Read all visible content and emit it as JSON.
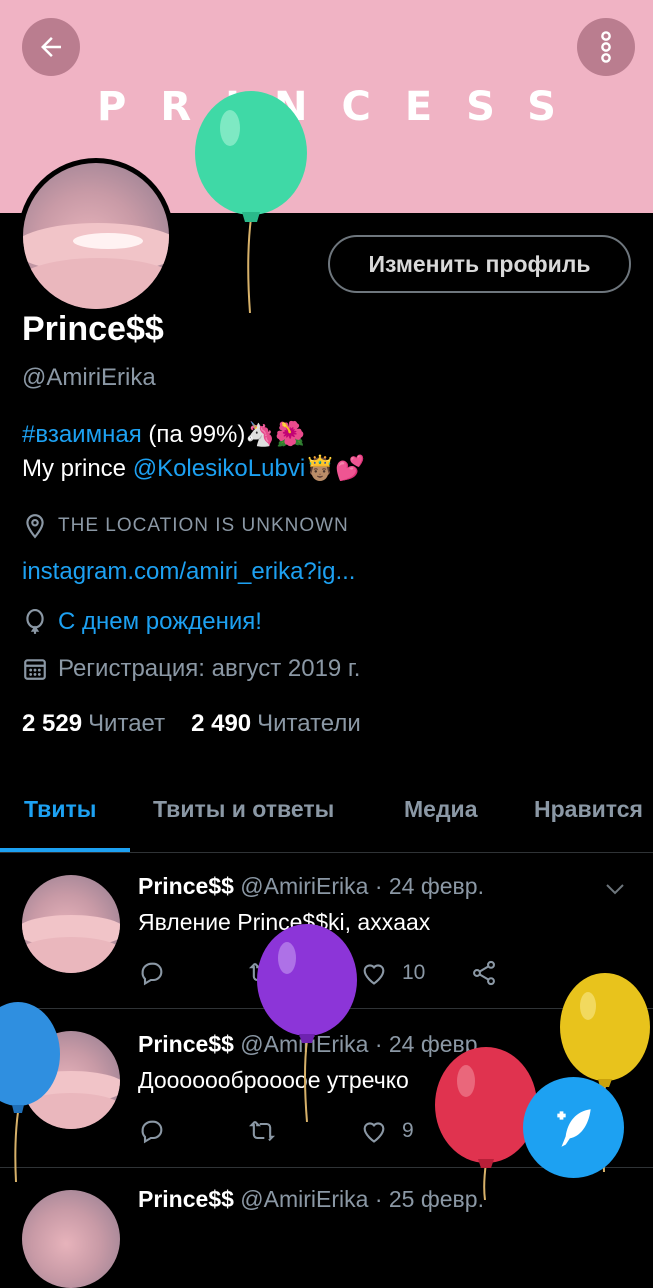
{
  "banner": {
    "text": "PRINCESS",
    "color": "#f0b3c4"
  },
  "header": {
    "back_icon": "arrow-left-icon",
    "menu_icon": "more-vertical-icon"
  },
  "profile": {
    "edit_button": "Изменить профиль",
    "name": "Prince$$",
    "handle": "@AmiriErika",
    "bio_hashtag": "#взаимная",
    "bio_line1_rest": " (па 99%)🦄🌺",
    "bio_line2_prefix": "My prince ",
    "bio_mention": "@KolesikoLubvi",
    "bio_line2_emoji": "🤴🏽💕",
    "location": "THE LOCATION IS UNKNOWN",
    "link": "instagram.com/amiri_erika?ig...",
    "birthday": "С днем рождения!",
    "joined": "Регистрация: август 2019 г.",
    "following_count": "2 529",
    "following_label": "Читает",
    "followers_count": "2 490",
    "followers_label": "Читатели"
  },
  "tabs": [
    {
      "label": "Твиты",
      "active": true
    },
    {
      "label": "Твиты и ответы",
      "active": false
    },
    {
      "label": "Медиа",
      "active": false
    },
    {
      "label": "Нравится",
      "active": false
    }
  ],
  "tweets": [
    {
      "name": "Prince$$",
      "meta": " @AmiriErika · 24 февр.",
      "text": "Явление Prince$$ki, аxxaax",
      "likes": "10"
    },
    {
      "name": "Prince$$",
      "meta": " @AmiriErika · 24 февр.",
      "text": "Дооооооброоооe утречко",
      "likes": "9"
    },
    {
      "name": "Prince$$",
      "meta": " @AmiriErika · 25 февр."
    }
  ],
  "colors": {
    "accent": "#1da1f2",
    "muted": "#8b98a5",
    "background": "#000000"
  }
}
